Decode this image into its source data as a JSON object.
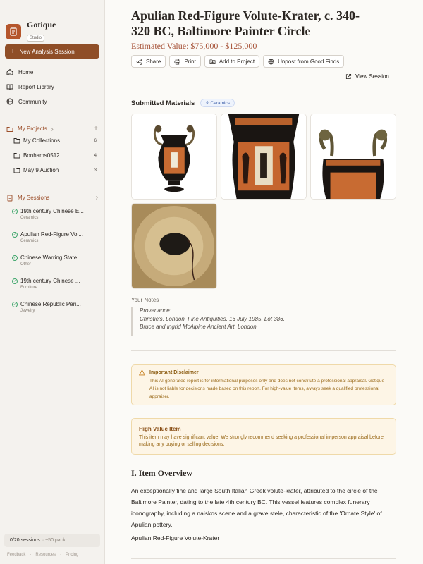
{
  "app": {
    "name": "Gotique",
    "badge": "Studio"
  },
  "sidebar": {
    "new_session": "New Analysis Session",
    "nav": [
      {
        "label": "Home",
        "icon": "home-icon"
      },
      {
        "label": "Report Library",
        "icon": "book-icon"
      },
      {
        "label": "Community",
        "icon": "globe-icon"
      }
    ],
    "projects_title": "My Projects",
    "projects": [
      {
        "label": "My Collections",
        "count": "6"
      },
      {
        "label": "Bonhams0512",
        "count": "4"
      },
      {
        "label": "May 9 Auction",
        "count": "3"
      }
    ],
    "sessions_title": "My Sessions",
    "sessions": [
      {
        "title": "19th century Chinese E...",
        "category": "Ceramics"
      },
      {
        "title": "Apulian Red-Figure Vol...",
        "category": "Ceramics"
      },
      {
        "title": "Chinese Warring State...",
        "category": "Other"
      },
      {
        "title": "19th century Chinese ...",
        "category": "Furniture"
      },
      {
        "title": "Chinese Republic Peri...",
        "category": "Jewelry"
      }
    ],
    "usage": "0/20 sessions",
    "usage_extra": "· ~50 pack",
    "footer": [
      "Feedback",
      "Resources",
      "Pricing"
    ]
  },
  "report": {
    "title": "Apulian Red-Figure Volute-Krater, c. 340-320 BC, Baltimore Painter Circle",
    "estimated_value": "Estimated Value: $75,000 - $125,000",
    "actions": {
      "share": "Share",
      "print": "Print",
      "add_to_project": "Add to Project",
      "unpost": "Unpost from Good Finds",
      "view_session": "View Session"
    },
    "submitted_title": "Submitted Materials",
    "category_chip": "Ceramics",
    "notes_label": "Your Notes",
    "notes": [
      "Provenance:",
      "Christie's, London, Fine Antiquities, 16 July 1985, Lot 386.",
      "Bruce and Ingrid McAlpine Ancient Art, London."
    ],
    "disclaimer": {
      "title": "Important Disclaimer",
      "body": "This AI-generated report is for informational purposes only and does not constitute a professional appraisal. Gotique AI is not liable for decisions made based on this report. For high-value items, always seek a qualified professional appraiser."
    },
    "high_value": {
      "title": "High Value Item",
      "body": "This item may have significant value. We strongly recommend seeking a professional in-person appraisal before making any buying or selling decisions."
    },
    "section_title": "I. Item Overview",
    "overview": "An exceptionally fine and large South Italian Greek volute-krater, attributed to the circle of the Baltimore Painter, dating to the late 4th century BC. This vessel features complex funerary iconography, including a naiskos scene and a grave stele, characteristic of the 'Ornate Style' of Apulian pottery.",
    "overview_sub": "Apulian Red-Figure Volute-Krater"
  },
  "colors": {
    "accent": "#8f4e27",
    "estimate": "#a8553b",
    "warning_bg": "#fdf5e6"
  }
}
